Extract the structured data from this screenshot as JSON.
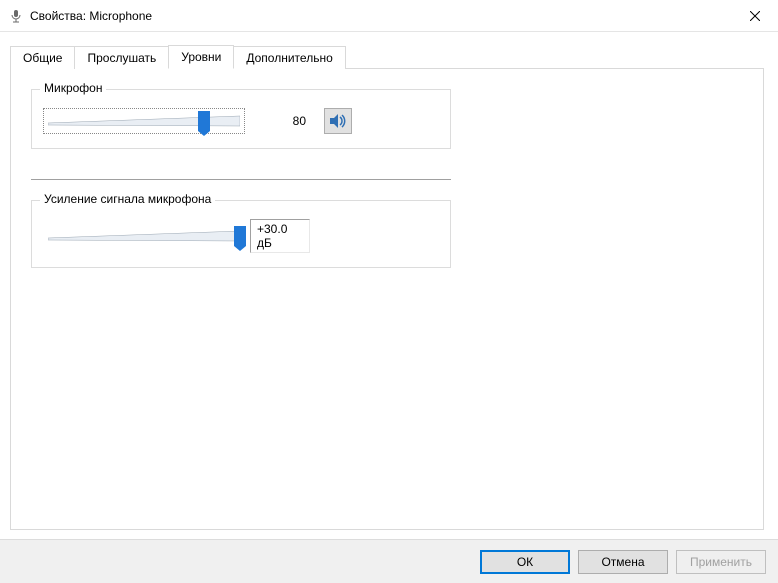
{
  "window": {
    "title": "Свойства: Microphone"
  },
  "tabs": {
    "general": "Общие",
    "listen": "Прослушать",
    "levels": "Уровни",
    "advanced": "Дополнительно",
    "active": "levels"
  },
  "levels": {
    "mic": {
      "label": "Микрофон",
      "value": "80",
      "percent": 80
    },
    "boost": {
      "label": "Усиление сигнала микрофона",
      "value": "+30.0 дБ",
      "percent": 100
    }
  },
  "buttons": {
    "ok": "ОК",
    "cancel": "Отмена",
    "apply": "Применить"
  },
  "colors": {
    "accent": "#0078d7",
    "thumb": "#2078d7",
    "border": "#d9d9d9"
  }
}
